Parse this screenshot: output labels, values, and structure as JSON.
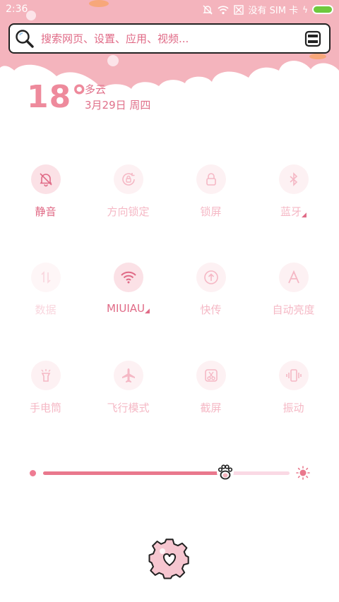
{
  "status_bar": {
    "time": "2:36",
    "carrier": "没有 SIM 卡",
    "icons": [
      "mute-bell-icon",
      "wifi-icon",
      "no-sim-icon",
      "charging-bolt-icon",
      "battery-icon"
    ]
  },
  "search": {
    "placeholder": "搜索网页、设置、应用、视频..."
  },
  "weather": {
    "temperature": "18°",
    "condition": "多云",
    "date": "3月29日 周四"
  },
  "toggles": [
    {
      "label": "静音",
      "icon": "bell-off-icon",
      "state": "on"
    },
    {
      "label": "方向锁定",
      "icon": "rotation-lock-icon",
      "state": "off"
    },
    {
      "label": "锁屏",
      "icon": "lock-icon",
      "state": "off"
    },
    {
      "label": "蓝牙",
      "icon": "bluetooth-icon",
      "state": "off"
    },
    {
      "label": "数据",
      "icon": "data-arrows-icon",
      "state": "disabled"
    },
    {
      "label": "MIUIAU",
      "icon": "wifi-icon",
      "state": "on"
    },
    {
      "label": "快传",
      "icon": "transfer-icon",
      "state": "off"
    },
    {
      "label": "自动亮度",
      "icon": "auto-brightness-icon",
      "state": "off"
    },
    {
      "label": "手电筒",
      "icon": "flashlight-icon",
      "state": "off"
    },
    {
      "label": "飞行模式",
      "icon": "airplane-icon",
      "state": "off"
    },
    {
      "label": "截屏",
      "icon": "screenshot-icon",
      "state": "off"
    },
    {
      "label": "振动",
      "icon": "vibrate-icon",
      "state": "off"
    }
  ],
  "brightness": {
    "level": 0.74
  },
  "colors": {
    "header_pink": "#f4b4bd",
    "accent": "#e06a86"
  }
}
